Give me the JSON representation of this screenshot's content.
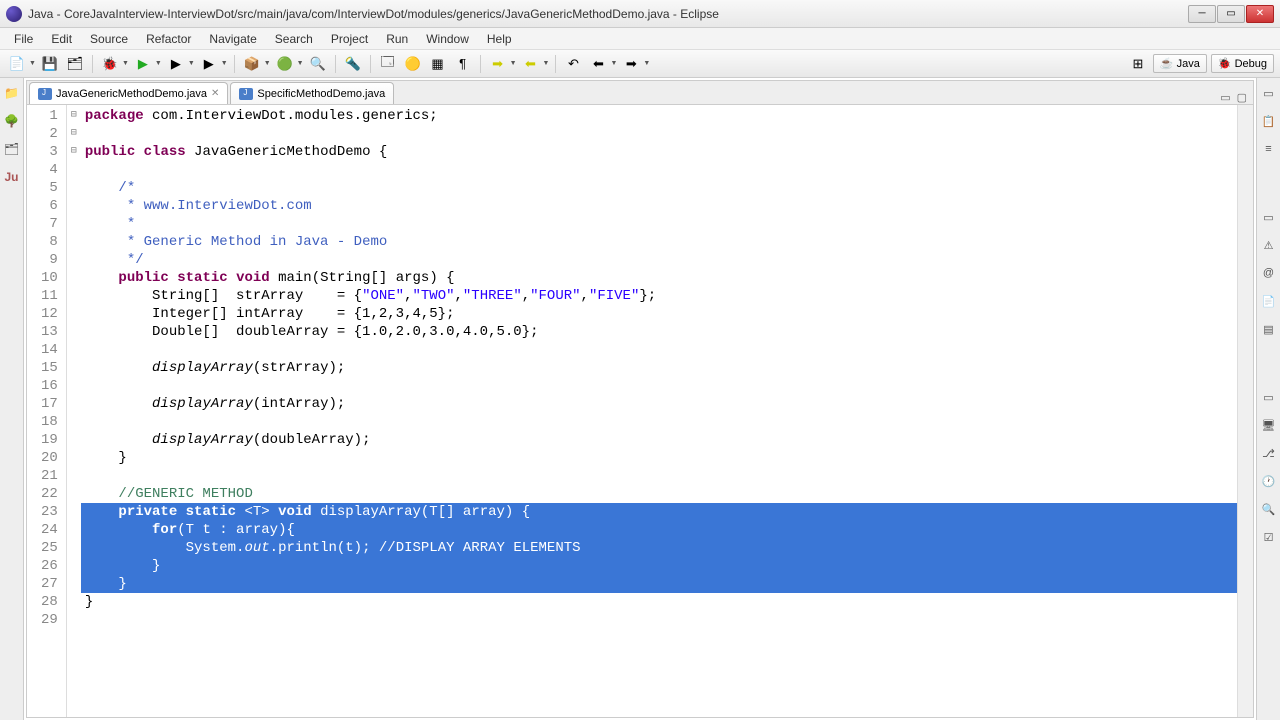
{
  "window": {
    "title": "Java - CoreJavaInterview-InterviewDot/src/main/java/com/InterviewDot/modules/generics/JavaGenericMethodDemo.java - Eclipse"
  },
  "menu": [
    "File",
    "Edit",
    "Source",
    "Refactor",
    "Navigate",
    "Search",
    "Project",
    "Run",
    "Window",
    "Help"
  ],
  "perspectives": {
    "java": "Java",
    "debug": "Debug"
  },
  "tabs": [
    {
      "label": "JavaGenericMethodDemo.java",
      "active": true
    },
    {
      "label": "SpecificMethodDemo.java",
      "active": false
    }
  ],
  "code": {
    "lines": [
      {
        "n": 1,
        "t": [
          [
            "kw",
            "package"
          ],
          [
            "",
            " com.InterviewDot.modules.generics;"
          ]
        ]
      },
      {
        "n": 2,
        "t": [
          [
            "",
            ""
          ]
        ]
      },
      {
        "n": 3,
        "t": [
          [
            "kw",
            "public"
          ],
          [
            "",
            " "
          ],
          [
            "kw",
            "class"
          ],
          [
            "",
            " JavaGenericMethodDemo {"
          ]
        ]
      },
      {
        "n": 4,
        "t": [
          [
            "",
            ""
          ]
        ]
      },
      {
        "n": 5,
        "t": [
          [
            "",
            "    "
          ],
          [
            "jd",
            "/*"
          ]
        ],
        "fold": "-"
      },
      {
        "n": 6,
        "t": [
          [
            "",
            "     "
          ],
          [
            "jd",
            "* www.InterviewDot.com"
          ]
        ]
      },
      {
        "n": 7,
        "t": [
          [
            "",
            "     "
          ],
          [
            "jd",
            "*"
          ]
        ]
      },
      {
        "n": 8,
        "t": [
          [
            "",
            "     "
          ],
          [
            "jd",
            "* Generic Method in Java - Demo"
          ]
        ]
      },
      {
        "n": 9,
        "t": [
          [
            "",
            "     "
          ],
          [
            "jd",
            "*/"
          ]
        ]
      },
      {
        "n": 10,
        "t": [
          [
            "",
            "    "
          ],
          [
            "kw",
            "public"
          ],
          [
            "",
            " "
          ],
          [
            "kw",
            "static"
          ],
          [
            "",
            " "
          ],
          [
            "kw",
            "void"
          ],
          [
            "",
            " main(String[] args) {"
          ]
        ],
        "fold": "-"
      },
      {
        "n": 11,
        "t": [
          [
            "",
            "        String[]  strArray    = {"
          ],
          [
            "str",
            "\"ONE\""
          ],
          [
            "",
            ","
          ],
          [
            "str",
            "\"TWO\""
          ],
          [
            "",
            ","
          ],
          [
            "str",
            "\"THREE\""
          ],
          [
            "",
            ","
          ],
          [
            "str",
            "\"FOUR\""
          ],
          [
            "",
            ","
          ],
          [
            "str",
            "\"FIVE\""
          ],
          [
            "",
            "};"
          ]
        ]
      },
      {
        "n": 12,
        "t": [
          [
            "",
            "        Integer[] intArray    = {1,2,3,4,5};"
          ]
        ]
      },
      {
        "n": 13,
        "t": [
          [
            "",
            "        Double[]  doubleArray = {1.0,2.0,3.0,4.0,5.0};"
          ]
        ]
      },
      {
        "n": 14,
        "t": [
          [
            "",
            ""
          ]
        ]
      },
      {
        "n": 15,
        "t": [
          [
            "",
            "        "
          ],
          [
            "it",
            "displayArray"
          ],
          [
            "",
            "(strArray);"
          ]
        ]
      },
      {
        "n": 16,
        "t": [
          [
            "",
            ""
          ]
        ]
      },
      {
        "n": 17,
        "t": [
          [
            "",
            "        "
          ],
          [
            "it",
            "displayArray"
          ],
          [
            "",
            "(intArray);"
          ]
        ]
      },
      {
        "n": 18,
        "t": [
          [
            "",
            ""
          ]
        ]
      },
      {
        "n": 19,
        "t": [
          [
            "",
            "        "
          ],
          [
            "it",
            "displayArray"
          ],
          [
            "",
            "(doubleArray);"
          ]
        ]
      },
      {
        "n": 20,
        "t": [
          [
            "",
            "    }"
          ]
        ]
      },
      {
        "n": 21,
        "t": [
          [
            "",
            ""
          ]
        ]
      },
      {
        "n": 22,
        "t": [
          [
            "",
            "    "
          ],
          [
            "cm",
            "//GENERIC METHOD"
          ]
        ]
      },
      {
        "n": 23,
        "t": [
          [
            "",
            "    "
          ],
          [
            "kw",
            "private"
          ],
          [
            "",
            " "
          ],
          [
            "kw",
            "static"
          ],
          [
            "",
            " <T> "
          ],
          [
            "kw",
            "void"
          ],
          [
            "",
            " displayArray(T[] array) {"
          ]
        ],
        "sel": true,
        "fold": "-"
      },
      {
        "n": 24,
        "t": [
          [
            "",
            "        "
          ],
          [
            "kw",
            "for"
          ],
          [
            "",
            "(T t : array){"
          ]
        ],
        "sel": true
      },
      {
        "n": 25,
        "t": [
          [
            "",
            "            System."
          ],
          [
            "it",
            "out"
          ],
          [
            "",
            ".println(t); "
          ],
          [
            "cm",
            "//DISPLAY ARRAY ELEMENTS"
          ]
        ],
        "sel": true
      },
      {
        "n": 26,
        "t": [
          [
            "",
            "        }"
          ]
        ],
        "sel": true
      },
      {
        "n": 27,
        "t": [
          [
            "",
            "    }"
          ]
        ],
        "sel": true
      },
      {
        "n": 28,
        "t": [
          [
            "",
            "}"
          ]
        ]
      },
      {
        "n": 29,
        "t": [
          [
            "",
            ""
          ]
        ]
      }
    ]
  }
}
